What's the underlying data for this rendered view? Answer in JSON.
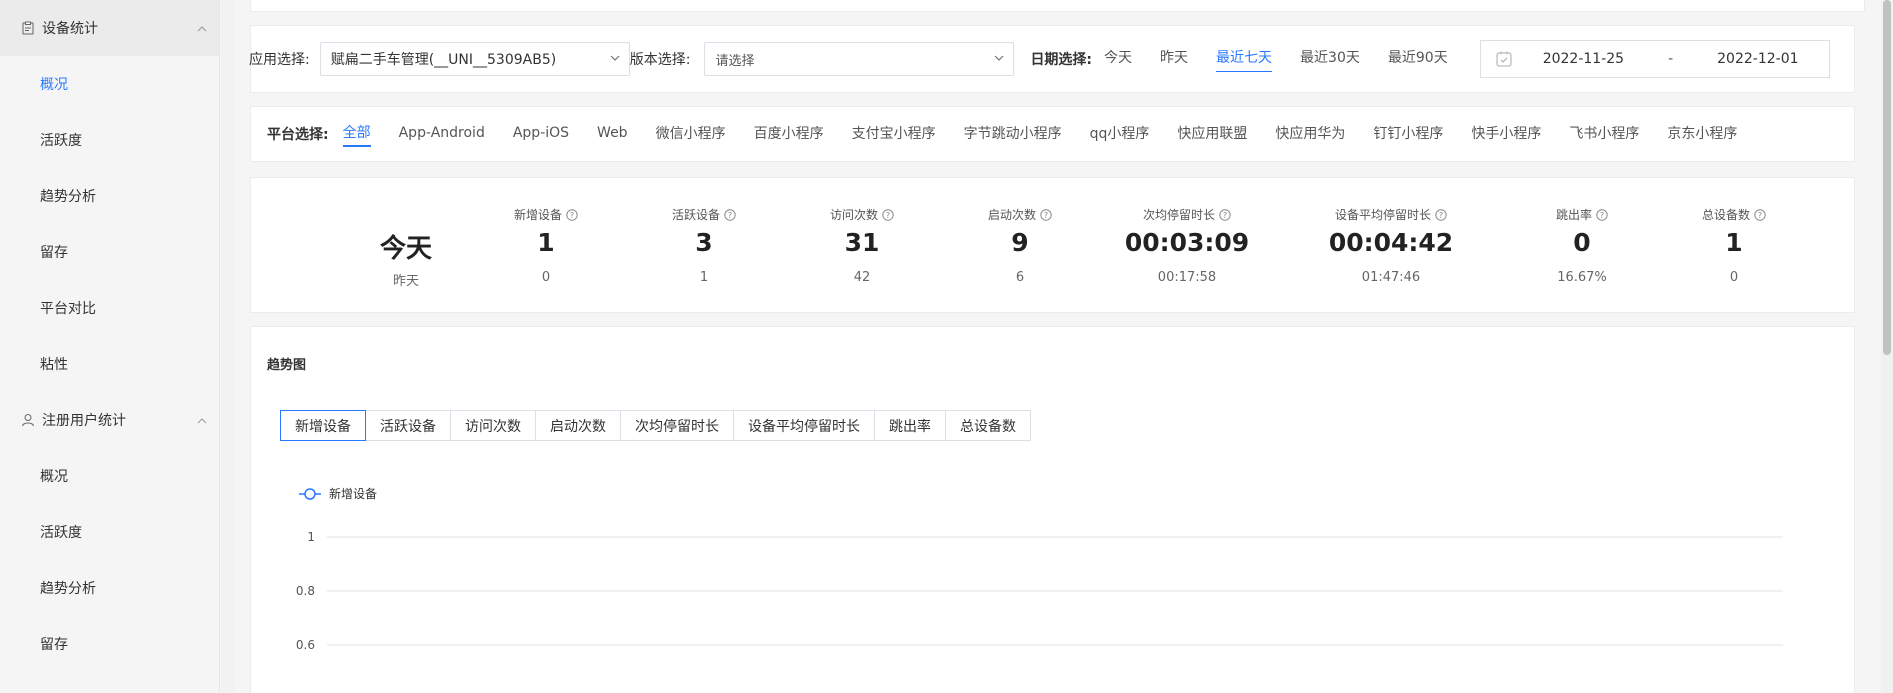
{
  "sidebar": {
    "groups": [
      {
        "label": "设备统计",
        "items": [
          "概况",
          "活跃度",
          "趋势分析",
          "留存",
          "平台对比",
          "粘性"
        ]
      },
      {
        "label": "注册用户统计",
        "items": [
          "概况",
          "活跃度",
          "趋势分析",
          "留存"
        ]
      }
    ]
  },
  "filter": {
    "app_label": "应用选择:",
    "app_value": "赋扁二手车管理(__UNI__5309AB5)",
    "version_label": "版本选择:",
    "version_placeholder": "请选择",
    "date_label": "日期选择:",
    "date_options": [
      "今天",
      "昨天",
      "最近七天",
      "最近30天",
      "最近90天"
    ],
    "date_active": "最近七天",
    "start_date": "2022-11-25",
    "range_sep": "-",
    "end_date": "2022-12-01"
  },
  "platform": {
    "label": "平台选择:",
    "tabs": [
      "全部",
      "App-Android",
      "App-iOS",
      "Web",
      "微信小程序",
      "百度小程序",
      "支付宝小程序",
      "字节跳动小程序",
      "qq小程序",
      "快应用联盟",
      "快应用华为",
      "钉钉小程序",
      "快手小程序",
      "飞书小程序",
      "京东小程序"
    ],
    "active": "全部"
  },
  "stats": {
    "today_label": "今天",
    "yesterday_label": "昨天",
    "metrics": [
      {
        "label": "新增设备",
        "today": "1",
        "yesterday": "0"
      },
      {
        "label": "活跃设备",
        "today": "3",
        "yesterday": "1"
      },
      {
        "label": "访问次数",
        "today": "31",
        "yesterday": "42"
      },
      {
        "label": "启动次数",
        "today": "9",
        "yesterday": "6"
      },
      {
        "label": "次均停留时长",
        "today": "00:03:09",
        "yesterday": "00:17:58"
      },
      {
        "label": "设备平均停留时长",
        "today": "00:04:42",
        "yesterday": "01:47:46"
      },
      {
        "label": "跳出率",
        "today": "0",
        "yesterday": "16.67%"
      },
      {
        "label": "总设备数",
        "today": "1",
        "yesterday": "0"
      }
    ]
  },
  "trend": {
    "title": "趋势图",
    "tabs": [
      "新增设备",
      "活跃设备",
      "访问次数",
      "启动次数",
      "次均停留时长",
      "设备平均停留时长",
      "跳出率",
      "总设备数"
    ],
    "active": "新增设备"
  },
  "chart_data": {
    "type": "line",
    "title": "",
    "xlabel": "",
    "ylabel": "",
    "series": [
      {
        "name": "新增设备",
        "values": []
      }
    ],
    "y_ticks": [
      "1",
      "0.8",
      "0.6"
    ],
    "grid": true,
    "legend": "top-left",
    "colors": {
      "series": "#2979ff",
      "grid": "#e0e0e0"
    }
  },
  "colors": {
    "accent": "#2979ff"
  },
  "icons": {
    "device_group": "clipboard-icon",
    "user_group": "user-icon",
    "collapse": "chevron-up-icon",
    "dropdown": "chevron-down-icon",
    "calendar": "calendar-icon",
    "help": "question-circle-icon"
  }
}
